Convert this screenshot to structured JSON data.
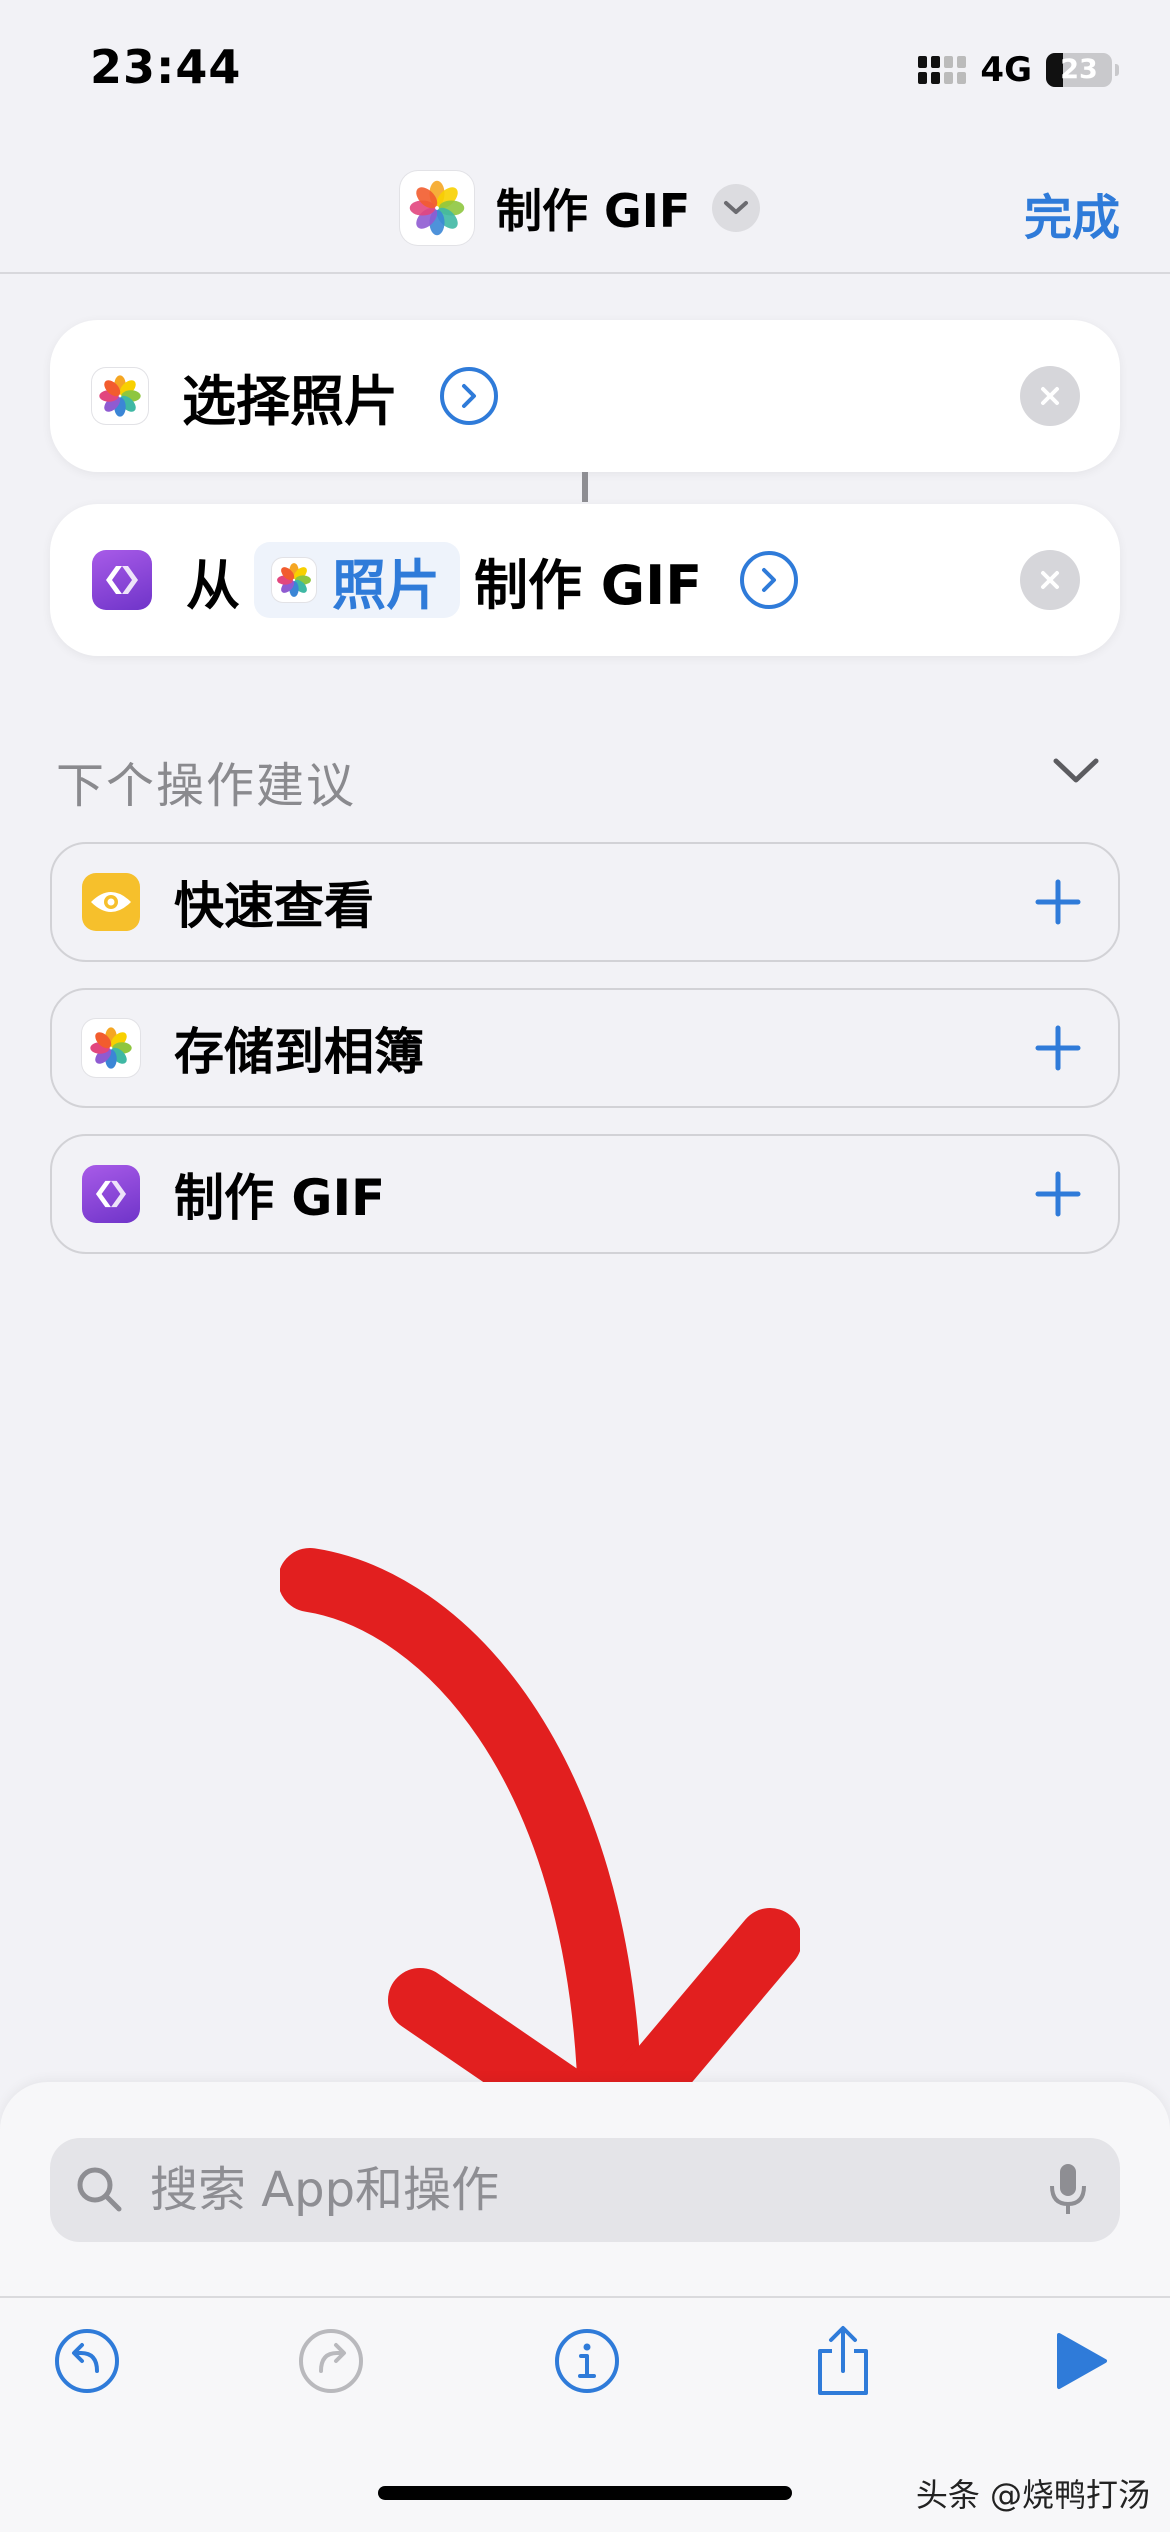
{
  "status": {
    "time": "23:44",
    "network": "4G",
    "battery": "23"
  },
  "header": {
    "title": "制作 GIF",
    "done_label": "完成"
  },
  "actions": [
    {
      "text": "选择照片"
    },
    {
      "prefix": "从",
      "token": "照片",
      "suffix": "制作 GIF"
    }
  ],
  "suggestions": {
    "title": "下个操作建议",
    "items": [
      {
        "label": "快速查看",
        "icon": "eye-icon"
      },
      {
        "label": "存储到相簿",
        "icon": "photos-icon"
      },
      {
        "label": "制作 GIF",
        "icon": "make-gif-icon"
      }
    ]
  },
  "search": {
    "placeholder": "搜索 App和操作"
  },
  "toolbar": {
    "icons": [
      "undo-icon",
      "redo-icon",
      "info-icon",
      "share-icon",
      "play-icon"
    ]
  },
  "watermark": "头条 @烧鸭打汤",
  "colors": {
    "accent": "#2f7bd9",
    "annotation_arrow": "#e21f1f"
  }
}
